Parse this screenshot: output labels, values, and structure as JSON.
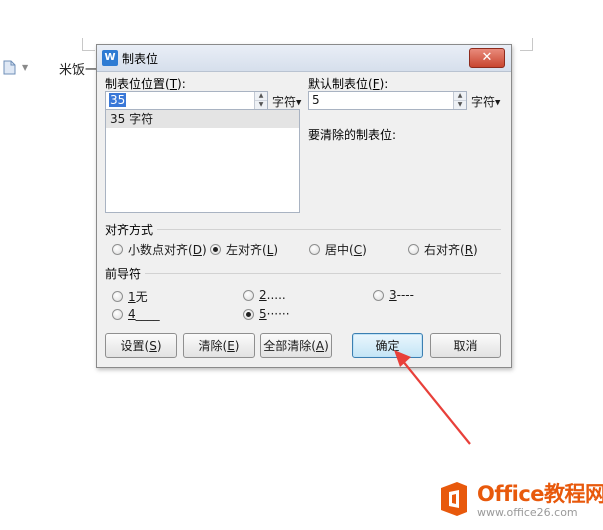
{
  "background": {
    "doc_text": "米饭一"
  },
  "dialog": {
    "title": "制表位",
    "app_icon": "W",
    "close_glyph": "✕",
    "tab_position": {
      "label_pre": "制表位位置(",
      "label_key": "T",
      "label_post": "):",
      "value": "35",
      "unit": "字符"
    },
    "default_tab": {
      "label_pre": "默认制表位(",
      "label_key": "F",
      "label_post": "):",
      "value": "5",
      "unit": "字符"
    },
    "to_clear_label": "要清除的制表位:",
    "tab_list": [
      "35 字符"
    ],
    "alignment": {
      "label": "对齐方式",
      "options": [
        {
          "pre": "小数点对齐(",
          "key": "D",
          "post": ")",
          "selected": false
        },
        {
          "pre": "左对齐(",
          "key": "L",
          "post": ")",
          "selected": true
        },
        {
          "pre": "居中(",
          "key": "C",
          "post": ")",
          "selected": false
        },
        {
          "pre": "右对齐(",
          "key": "R",
          "post": ")",
          "selected": false
        }
      ]
    },
    "leader": {
      "label": "前导符",
      "options": [
        {
          "key": "1",
          "text": " 无",
          "selected": false
        },
        {
          "key": "2",
          "text": " .....",
          "selected": false
        },
        {
          "key": "3",
          "text": " ----",
          "selected": false
        },
        {
          "key": "4",
          "text": " ____",
          "selected": false
        },
        {
          "key": "5",
          "text": " ······",
          "selected": true
        }
      ]
    },
    "buttons": {
      "set": {
        "pre": "设置(",
        "key": "S",
        "post": ")"
      },
      "clear": {
        "pre": "清除(",
        "key": "E",
        "post": ")"
      },
      "clear_all": {
        "pre": "全部清除(",
        "key": "A",
        "post": ")"
      },
      "ok": "确定",
      "cancel": "取消"
    }
  },
  "annotation": {
    "arrow_color": "#e8403a"
  },
  "watermark": {
    "title": "Office教程网",
    "url": "www.office26.com",
    "color": "#e8590c"
  }
}
